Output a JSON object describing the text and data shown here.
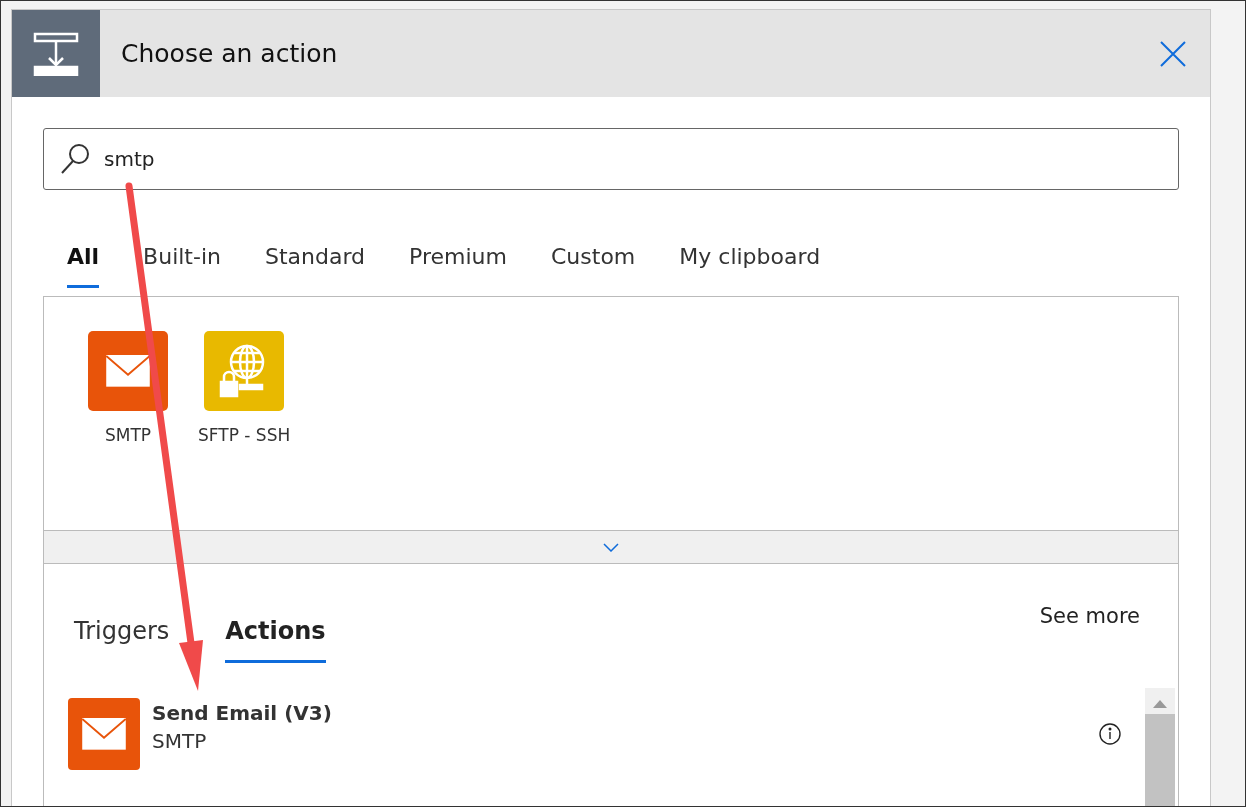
{
  "header": {
    "title": "Choose an action"
  },
  "search": {
    "value": "smtp"
  },
  "tabs": [
    {
      "label": "All",
      "selected": true
    },
    {
      "label": "Built-in",
      "selected": false
    },
    {
      "label": "Standard",
      "selected": false
    },
    {
      "label": "Premium",
      "selected": false
    },
    {
      "label": "Custom",
      "selected": false
    },
    {
      "label": "My clipboard",
      "selected": false
    }
  ],
  "connectors": [
    {
      "name": "SMTP",
      "kind": "mail",
      "color": "#e8540a"
    },
    {
      "name": "SFTP - SSH",
      "kind": "globe",
      "color": "#e8b900"
    }
  ],
  "subtabs": [
    {
      "label": "Triggers",
      "selected": false
    },
    {
      "label": "Actions",
      "selected": true
    }
  ],
  "see_more": "See more",
  "actions": [
    {
      "title": "Send Email (V3)",
      "connector": "SMTP",
      "kind": "mail",
      "color": "#e8540a"
    }
  ]
}
